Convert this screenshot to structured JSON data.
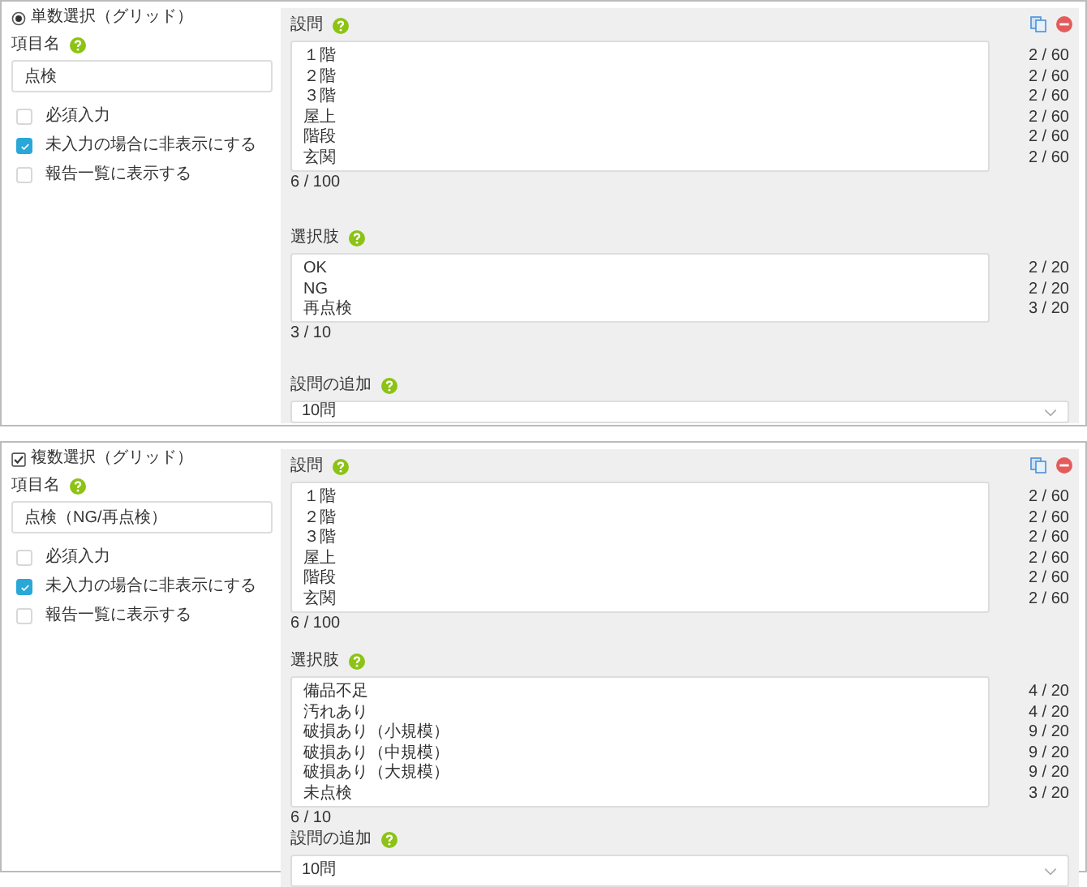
{
  "sections": [
    {
      "type": {
        "kind": "radio",
        "label": "単数選択（グリッド）",
        "checked": true
      },
      "item_name": {
        "label": "項目名",
        "value": "点検"
      },
      "options": [
        {
          "label": "必須入力",
          "checked": false
        },
        {
          "label": "未入力の場合に非表示にする",
          "checked": true
        },
        {
          "label": "報告一覧に表示する",
          "checked": false
        }
      ],
      "questions": {
        "label": "設問",
        "lines": [
          {
            "text": "１階",
            "count": "2 / 60"
          },
          {
            "text": "２階",
            "count": "2 / 60"
          },
          {
            "text": "３階",
            "count": "2 / 60"
          },
          {
            "text": "屋上",
            "count": "2 / 60"
          },
          {
            "text": "階段",
            "count": "2 / 60"
          },
          {
            "text": "玄関",
            "count": "2 / 60"
          }
        ],
        "total": "6 / 100"
      },
      "choices": {
        "label": "選択肢",
        "lines": [
          {
            "text": "OK",
            "count": "2 / 20"
          },
          {
            "text": "NG",
            "count": "2 / 20"
          },
          {
            "text": "再点検",
            "count": "3 / 20"
          }
        ],
        "total": "3 / 10"
      },
      "add": {
        "label": "設問の追加",
        "value": "10問"
      }
    },
    {
      "type": {
        "kind": "checkbox",
        "label": "複数選択（グリッド）",
        "checked": true
      },
      "item_name": {
        "label": "項目名",
        "value": "点検（NG/再点検）"
      },
      "options": [
        {
          "label": "必須入力",
          "checked": false
        },
        {
          "label": "未入力の場合に非表示にする",
          "checked": true
        },
        {
          "label": "報告一覧に表示する",
          "checked": false
        }
      ],
      "questions": {
        "label": "設問",
        "lines": [
          {
            "text": "１階",
            "count": "2 / 60"
          },
          {
            "text": "２階",
            "count": "2 / 60"
          },
          {
            "text": "３階",
            "count": "2 / 60"
          },
          {
            "text": "屋上",
            "count": "2 / 60"
          },
          {
            "text": "階段",
            "count": "2 / 60"
          },
          {
            "text": "玄関",
            "count": "2 / 60"
          }
        ],
        "total": "6 / 100"
      },
      "choices": {
        "label": "選択肢",
        "lines": [
          {
            "text": "備品不足",
            "count": "4 / 20"
          },
          {
            "text": "汚れあり",
            "count": "4 / 20"
          },
          {
            "text": "破損あり（小規模）",
            "count": "9 / 20"
          },
          {
            "text": "破損あり（中規模）",
            "count": "9 / 20"
          },
          {
            "text": "破損あり（大規模）",
            "count": "9 / 20"
          },
          {
            "text": "未点検",
            "count": "3 / 20"
          }
        ],
        "total": "6 / 10"
      },
      "add": {
        "label": "設問の追加",
        "value": "10問"
      }
    }
  ]
}
